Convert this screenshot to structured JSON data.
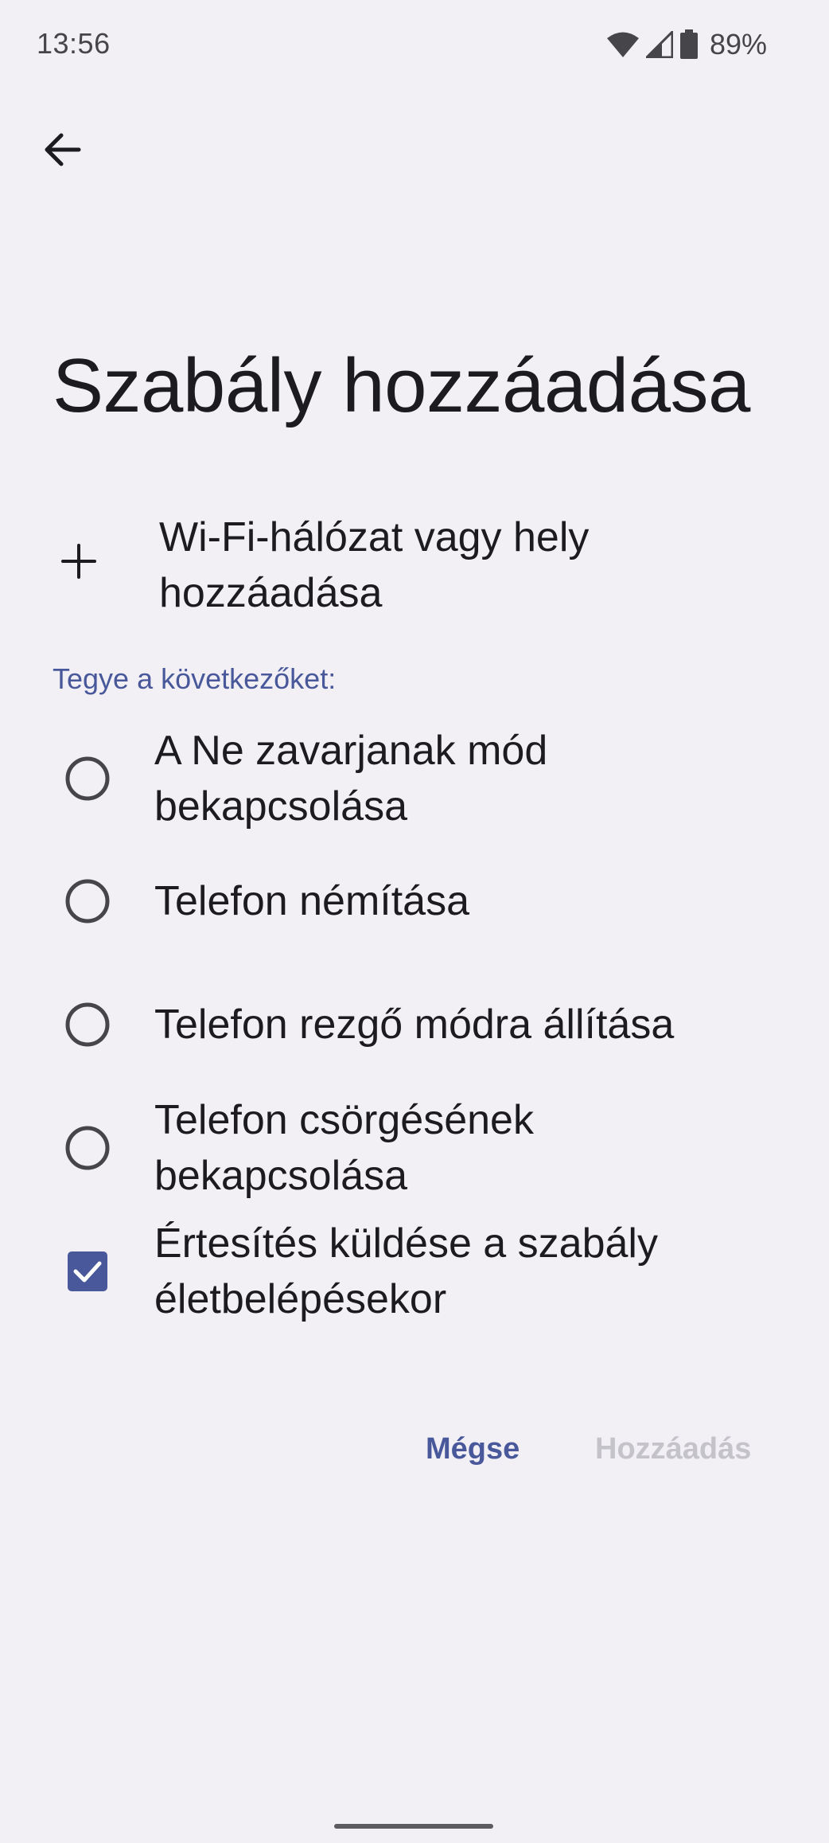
{
  "status_bar": {
    "time": "13:56",
    "battery_percent": "89%",
    "icons": [
      "wifi-icon",
      "signal-icon",
      "battery-icon"
    ]
  },
  "header": {
    "back_icon": "arrow-back-icon"
  },
  "page": {
    "title": "Szabály hozzáadása"
  },
  "add_location": {
    "icon": "plus-icon",
    "label": "Wi-Fi-hálózat vagy hely hozzáadása"
  },
  "actions": {
    "section_label": "Tegye a következőket:",
    "options": [
      {
        "label": "A Ne zavarjanak mód bekapcsolása",
        "type": "radio",
        "selected": false
      },
      {
        "label": "Telefon némítása",
        "type": "radio",
        "selected": false
      },
      {
        "label": "Telefon rezgő módra állítása",
        "type": "radio",
        "selected": false
      },
      {
        "label": "Telefon csörgésének bekapcsolása",
        "type": "radio",
        "selected": false
      },
      {
        "label": "Értesítés küldése a szabály életbelépésekor",
        "type": "checkbox",
        "checked": true
      }
    ]
  },
  "buttons": {
    "cancel": "Mégse",
    "add": "Hozzáadás",
    "add_enabled": false
  },
  "colors": {
    "background": "#f2f0f5",
    "accent": "#48589a",
    "disabled": "#c4c3c9",
    "text": "#1c1b1f"
  }
}
